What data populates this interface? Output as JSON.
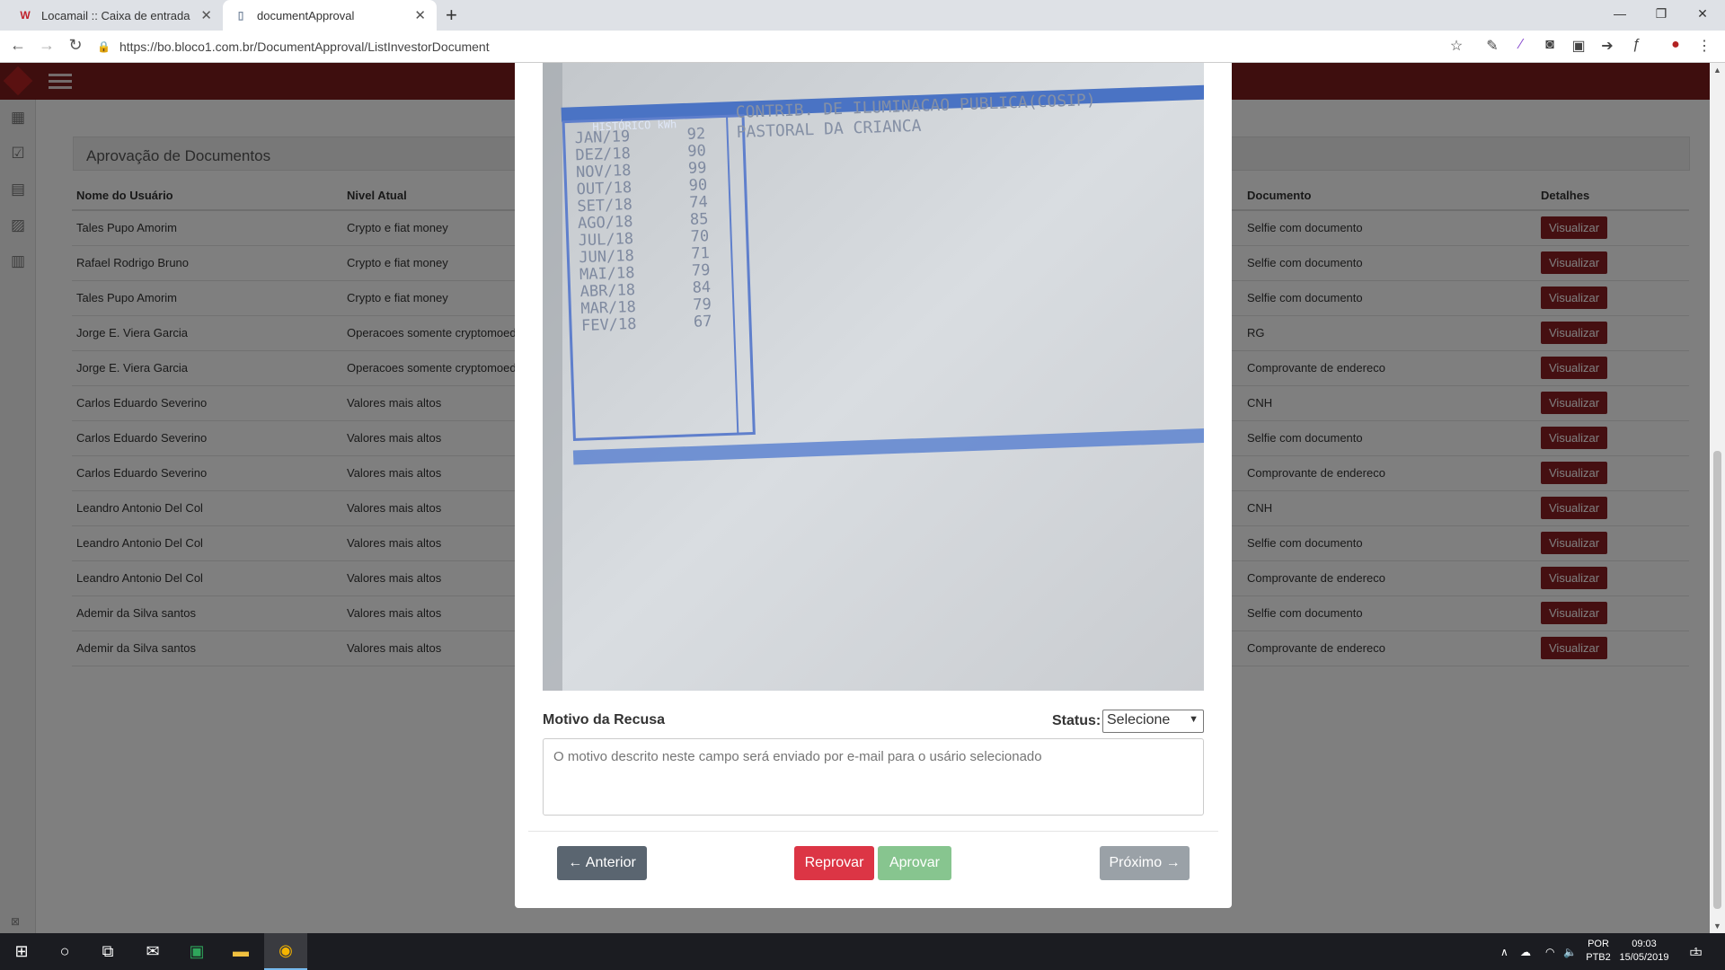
{
  "browser": {
    "tabs": [
      {
        "title": "Locamail :: Caixa de entrada",
        "icon": "webmail-w-icon"
      },
      {
        "title": "documentApproval",
        "icon": "page-icon"
      }
    ],
    "url": "https://bo.bloco1.com.br/DocumentApproval/ListInvestorDocument"
  },
  "panel": {
    "title": "Aprovação de Documentos"
  },
  "table": {
    "headers": {
      "user": "Nome do Usuário",
      "level": "Nivel Atual",
      "document": "Documento",
      "details": "Detalhes"
    },
    "rows": [
      {
        "user": "Tales Pupo Amorim",
        "level": "Crypto e fiat money",
        "document": "Selfie com documento",
        "action": "Visualizar"
      },
      {
        "user": "Rafael Rodrigo Bruno",
        "level": "Crypto e fiat money",
        "document": "Selfie com documento",
        "action": "Visualizar"
      },
      {
        "user": "Tales Pupo Amorim",
        "level": "Crypto e fiat money",
        "document": "Selfie com documento",
        "action": "Visualizar"
      },
      {
        "user": "Jorge E. Viera Garcia",
        "level": "Operacoes somente cryptomoed",
        "document": "RG",
        "action": "Visualizar"
      },
      {
        "user": "Jorge E. Viera Garcia",
        "level": "Operacoes somente cryptomoed",
        "document": "Comprovante de endereco",
        "action": "Visualizar"
      },
      {
        "user": "Carlos Eduardo Severino",
        "level": "Valores mais altos",
        "document": "CNH",
        "action": "Visualizar"
      },
      {
        "user": "Carlos Eduardo Severino",
        "level": "Valores mais altos",
        "document": "Selfie com documento",
        "action": "Visualizar"
      },
      {
        "user": "Carlos Eduardo Severino",
        "level": "Valores mais altos",
        "document": "Comprovante de endereco",
        "action": "Visualizar"
      },
      {
        "user": "Leandro Antonio Del Col",
        "level": "Valores mais altos",
        "document": "CNH",
        "action": "Visualizar"
      },
      {
        "user": "Leandro Antonio Del Col",
        "level": "Valores mais altos",
        "document": "Selfie com documento",
        "action": "Visualizar"
      },
      {
        "user": "Leandro Antonio Del Col",
        "level": "Valores mais altos",
        "document": "Comprovante de endereco",
        "action": "Visualizar"
      },
      {
        "user": "Ademir da Silva santos",
        "level": "Valores mais altos",
        "document": "Selfie com documento",
        "action": "Visualizar"
      },
      {
        "user": "Ademir da Silva santos",
        "level": "Valores mais altos",
        "document": "Comprovante de endereco",
        "action": "Visualizar"
      }
    ]
  },
  "modal": {
    "document_image": {
      "header": "HISTÓRICO kWh",
      "rows": [
        {
          "month": "JAN/19",
          "kwh": "92"
        },
        {
          "month": "DEZ/18",
          "kwh": "90"
        },
        {
          "month": "NOV/18",
          "kwh": "99"
        },
        {
          "month": "OUT/18",
          "kwh": "90"
        },
        {
          "month": "SET/18",
          "kwh": "74"
        },
        {
          "month": "AGO/18",
          "kwh": "85"
        },
        {
          "month": "JUL/18",
          "kwh": "70"
        },
        {
          "month": "JUN/18",
          "kwh": "71"
        },
        {
          "month": "MAI/18",
          "kwh": "79"
        },
        {
          "month": "ABR/18",
          "kwh": "84"
        },
        {
          "month": "MAR/18",
          "kwh": "79"
        },
        {
          "month": "FEV/18",
          "kwh": "67"
        }
      ],
      "text_line1": "CONTRIB. DE ILUMINACAO PUBLICA(COSIP)",
      "text_line2": "PASTORAL DA CRIANCA"
    },
    "motivo_label": "Motivo da Recusa",
    "status_label": "Status:",
    "status_value": "Selecione",
    "motivo_placeholder": "O motivo descrito neste campo será enviado por e-mail para o usário selecionado",
    "buttons": {
      "prev": "← Anterior",
      "reject": "Reprovar",
      "approve": "Aprovar",
      "next": "Próximo →"
    }
  },
  "taskbar": {
    "lang": "POR",
    "layout": "PTB2",
    "time": "09:03",
    "date": "15/05/2019",
    "notifications": "1"
  },
  "colors": {
    "brand": "#7c1d1d",
    "view_button": "#8a1f22",
    "reject": "#dc3545",
    "approve": "#87c58f"
  }
}
